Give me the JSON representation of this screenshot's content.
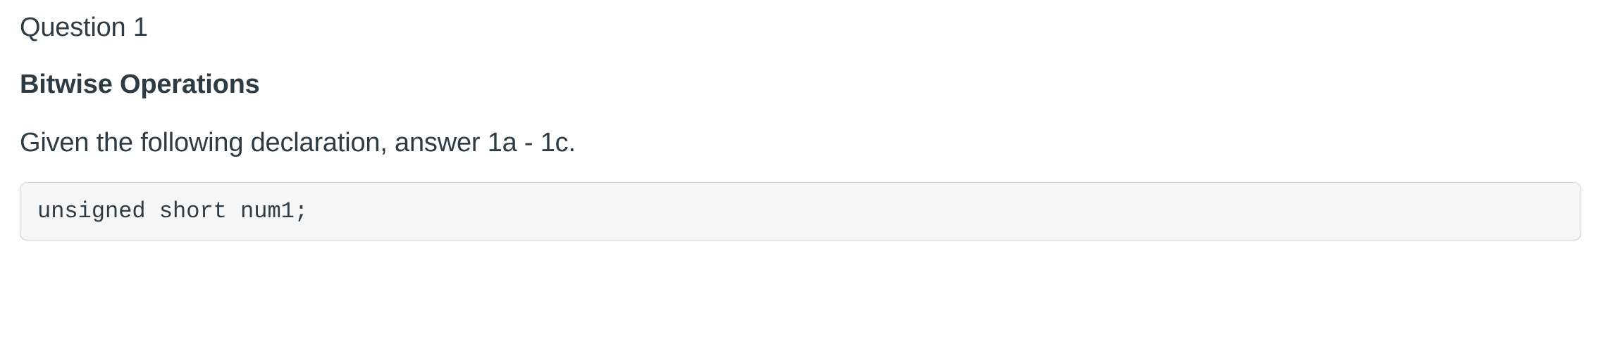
{
  "question": {
    "number": "Question 1",
    "section_title": "Bitwise Operations",
    "prompt": "Given the following declaration, answer 1a - 1c.",
    "code": "unsigned short num1;"
  }
}
